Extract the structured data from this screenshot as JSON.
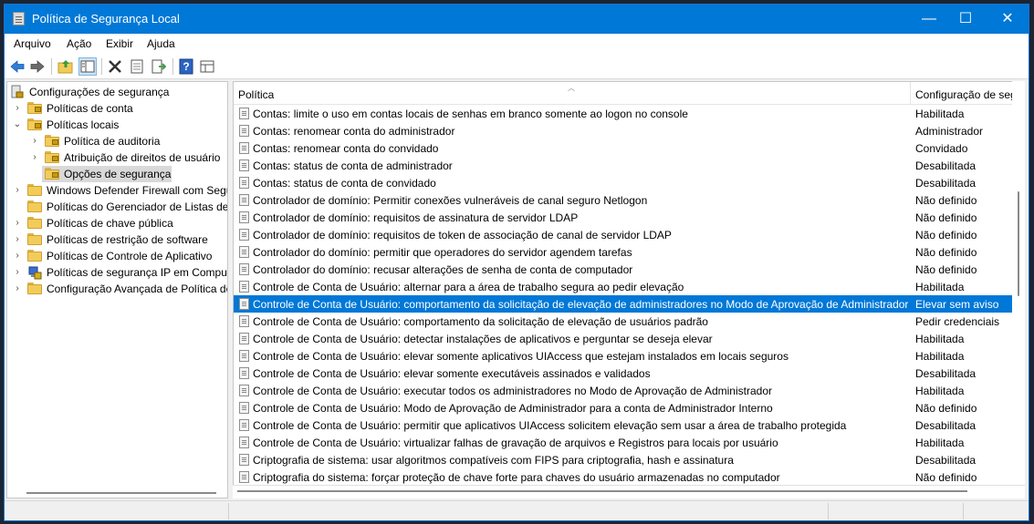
{
  "window": {
    "title": "Política de Segurança Local"
  },
  "window_controls": {
    "minimize": "—",
    "maximize": "☐",
    "close": "✕"
  },
  "menu": [
    "Arquivo",
    "Ação",
    "Exibir",
    "Ajuda"
  ],
  "tree": {
    "root": "Configurações de segurança",
    "items": [
      {
        "label": "Políticas de conta",
        "expander": "›"
      },
      {
        "label": "Políticas locais",
        "expander": "⌄"
      },
      {
        "label": "Política de auditoria",
        "expander": "›"
      },
      {
        "label": "Atribuição de direitos de usuário",
        "expander": "›"
      },
      {
        "label": "Opções de segurança",
        "expander": ""
      },
      {
        "label": "Windows Defender Firewall com Segurança Avançada",
        "expander": "›"
      },
      {
        "label": "Políticas do Gerenciador de Listas de Rede",
        "expander": ""
      },
      {
        "label": "Políticas de chave pública",
        "expander": "›"
      },
      {
        "label": "Políticas de restrição de software",
        "expander": "›"
      },
      {
        "label": "Políticas de Controle de Aplicativo",
        "expander": "›"
      },
      {
        "label": "Políticas de segurança IP em Computador Local",
        "expander": "›"
      },
      {
        "label": "Configuração Avançada de Política de Auditoria",
        "expander": "›"
      }
    ]
  },
  "list": {
    "col_policy": "Política",
    "col_setting": "Configuração de segurança",
    "rows": [
      {
        "policy": "Contas: limite o uso em contas locais de senhas em branco somente ao logon no console",
        "setting": "Habilitada"
      },
      {
        "policy": "Contas: renomear conta do administrador",
        "setting": "Administrador"
      },
      {
        "policy": "Contas: renomear conta do convidado",
        "setting": "Convidado"
      },
      {
        "policy": "Contas: status de conta de administrador",
        "setting": "Desabilitada"
      },
      {
        "policy": "Contas: status de conta de convidado",
        "setting": "Desabilitada"
      },
      {
        "policy": "Controlador de domínio: Permitir conexões vulneráveis de canal seguro Netlogon",
        "setting": "Não definido"
      },
      {
        "policy": "Controlador de domínio: requisitos de assinatura de servidor LDAP",
        "setting": "Não definido"
      },
      {
        "policy": "Controlador de domínio: requisitos de token de associação de canal de servidor LDAP",
        "setting": "Não definido"
      },
      {
        "policy": "Controlador do domínio: permitir que operadores do servidor agendem tarefas",
        "setting": "Não definido"
      },
      {
        "policy": "Controlador do domínio: recusar alterações de senha de conta de computador",
        "setting": "Não definido"
      },
      {
        "policy": "Controle de Conta de Usuário: alternar para a área de trabalho segura ao pedir elevação",
        "setting": "Habilitada"
      },
      {
        "policy": "Controle de Conta de Usuário: comportamento da solicitação de elevação de administradores no Modo de Aprovação de Administrador",
        "setting": "Elevar sem aviso"
      },
      {
        "policy": "Controle de Conta de Usuário: comportamento da solicitação de elevação de usuários padrão",
        "setting": "Pedir credenciais"
      },
      {
        "policy": "Controle de Conta de Usuário: detectar instalações de aplicativos e perguntar se deseja elevar",
        "setting": "Habilitada"
      },
      {
        "policy": "Controle de Conta de Usuário: elevar somente aplicativos UIAccess que estejam instalados em locais seguros",
        "setting": "Habilitada"
      },
      {
        "policy": "Controle de Conta de Usuário: elevar somente executáveis assinados e validados",
        "setting": "Desabilitada"
      },
      {
        "policy": "Controle de Conta de Usuário: executar todos os administradores no Modo de Aprovação de Administrador",
        "setting": "Habilitada"
      },
      {
        "policy": "Controle de Conta de Usuário: Modo de Aprovação de Administrador para a conta de Administrador Interno",
        "setting": "Não definido"
      },
      {
        "policy": "Controle de Conta de Usuário: permitir que aplicativos UIAccess solicitem elevação sem usar a área de trabalho protegida",
        "setting": "Desabilitada"
      },
      {
        "policy": "Controle de Conta de Usuário: virtualizar falhas de gravação de arquivos e Registros para locais por usuário",
        "setting": "Habilitada"
      },
      {
        "policy": "Criptografia de sistema: usar algoritmos compatíveis com FIPS para criptografia, hash e assinatura",
        "setting": "Desabilitada"
      },
      {
        "policy": "Criptografia do sistema: forçar proteção de chave forte para chaves do usuário armazenadas no computador",
        "setting": "Não definido"
      }
    ],
    "selected_index": 11
  },
  "colors": {
    "titlebar": "#0078d7",
    "selection": "#0078d7"
  },
  "icons": {
    "toolbar": [
      "back-arrow-icon",
      "forward-arrow-icon",
      "up-folder-icon",
      "show-tree-icon",
      "delete-icon",
      "properties-icon",
      "export-list-icon",
      "help-icon",
      "details-icon"
    ]
  }
}
